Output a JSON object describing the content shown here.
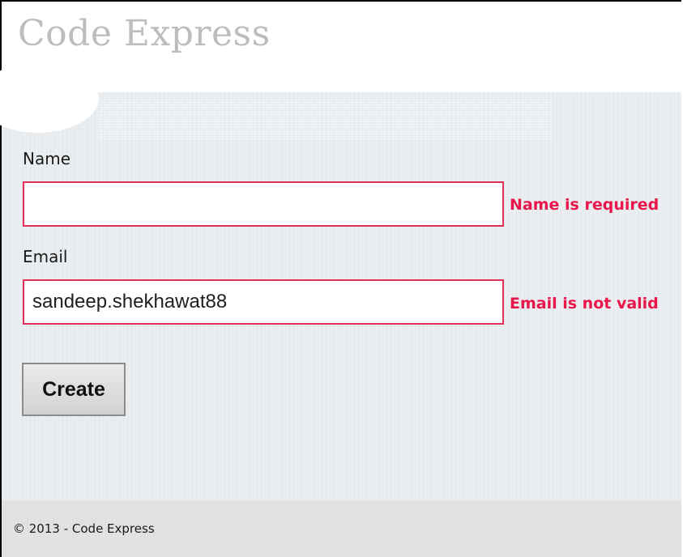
{
  "header": {
    "site_title": "Code Express"
  },
  "form": {
    "name": {
      "label": "Name",
      "value": "",
      "error": "Name is required"
    },
    "email": {
      "label": "Email",
      "value": "sandeep.shekhawat88",
      "error": "Email is not valid"
    },
    "submit_label": "Create"
  },
  "footer": {
    "copyright": "© 2013 - Code Express"
  },
  "colors": {
    "error_text": "#e8164a",
    "error_border": "#e0305a",
    "title_gray": "#bdbdbd",
    "content_bg": "#e9edef",
    "footer_bg": "#e3e3e3"
  }
}
